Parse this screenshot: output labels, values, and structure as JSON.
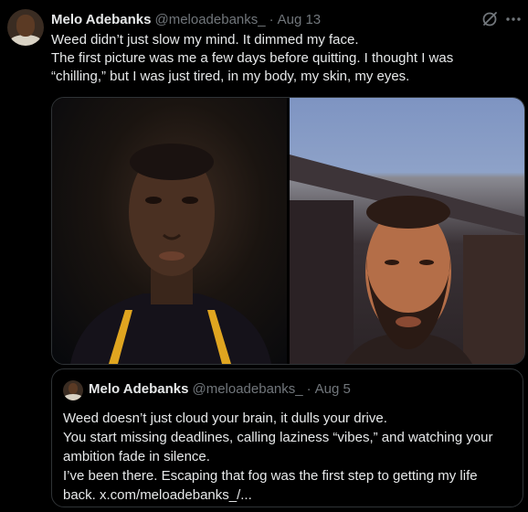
{
  "tweet": {
    "author_name": "Melo Adebanks",
    "handle": "@meloadebanks_",
    "separator": "·",
    "date": "Aug 13",
    "text_lines": [
      "Weed didn’t just slow my mind. It dimmed my face.",
      "The first picture was me a few days before quitting. I thought I was",
      "“chilling,” but I was just tired, in my body, my skin, my eyes."
    ],
    "icons": {
      "grok": "grok-icon",
      "more": "more-icon"
    },
    "media": [
      "photo-before-quitting",
      "photo-after-quitting"
    ]
  },
  "quote": {
    "author_name": "Melo Adebanks",
    "handle": "@meloadebanks_",
    "separator": "·",
    "date": "Aug 5",
    "text_lines": [
      "Weed doesn’t just cloud your brain, it dulls your drive.",
      "You start missing deadlines, calling laziness “vibes,” and watching your",
      "ambition fade in silence.",
      "I’ve been there. Escaping that fog was the first step to getting my life",
      "back. x.com/meloadebanks_/..."
    ]
  },
  "colors": {
    "background": "#000000",
    "text": "#e7e9ea",
    "muted": "#71767b",
    "border": "#2f3336"
  }
}
